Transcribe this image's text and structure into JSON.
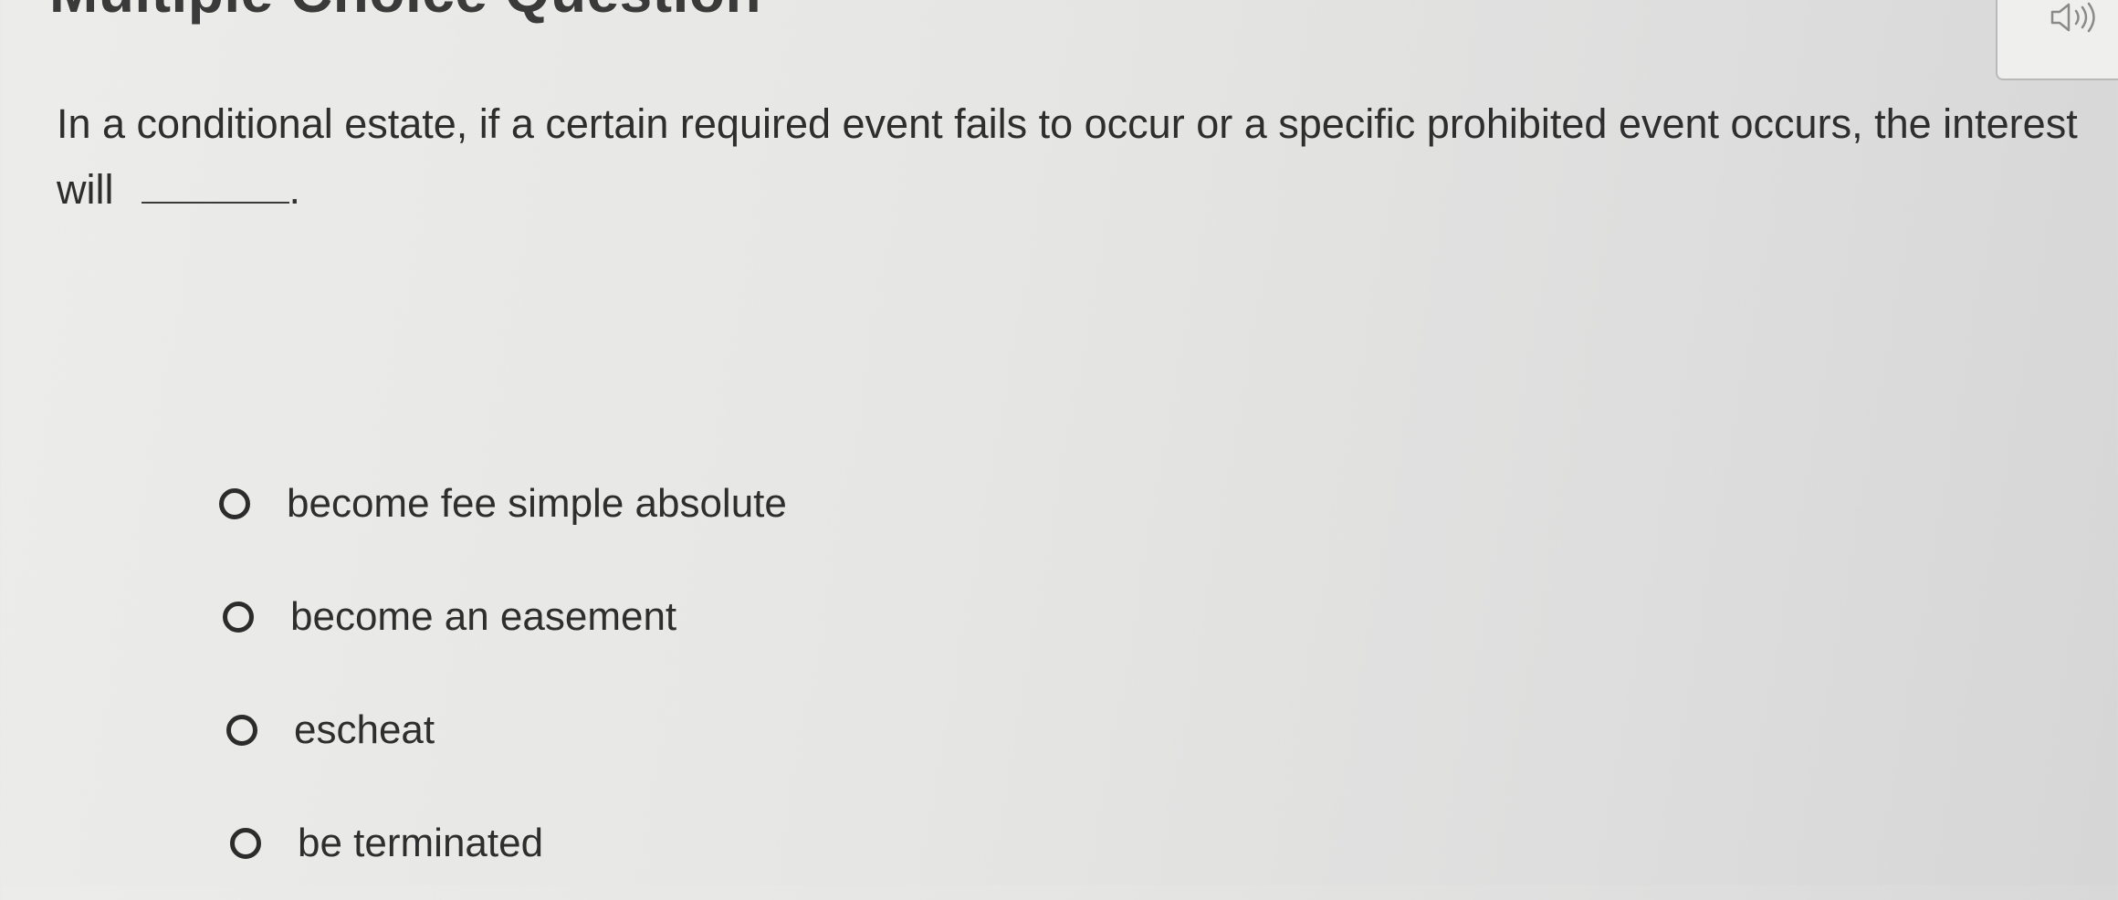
{
  "header": {
    "title": "Multiple Choice Question",
    "audio_icon": "speaker-icon"
  },
  "question": {
    "text_before_blank": "In a conditional estate, if a certain required event fails to occur or a specific prohibited event occurs, the interest will",
    "text_after_blank": "."
  },
  "options": [
    {
      "label": "become fee simple absolute"
    },
    {
      "label": "become an easement"
    },
    {
      "label": "escheat"
    },
    {
      "label": "be terminated"
    }
  ],
  "colors": {
    "text": "#2e2e2e",
    "background": "#e6e6e4",
    "border": "#b9b9b9"
  }
}
